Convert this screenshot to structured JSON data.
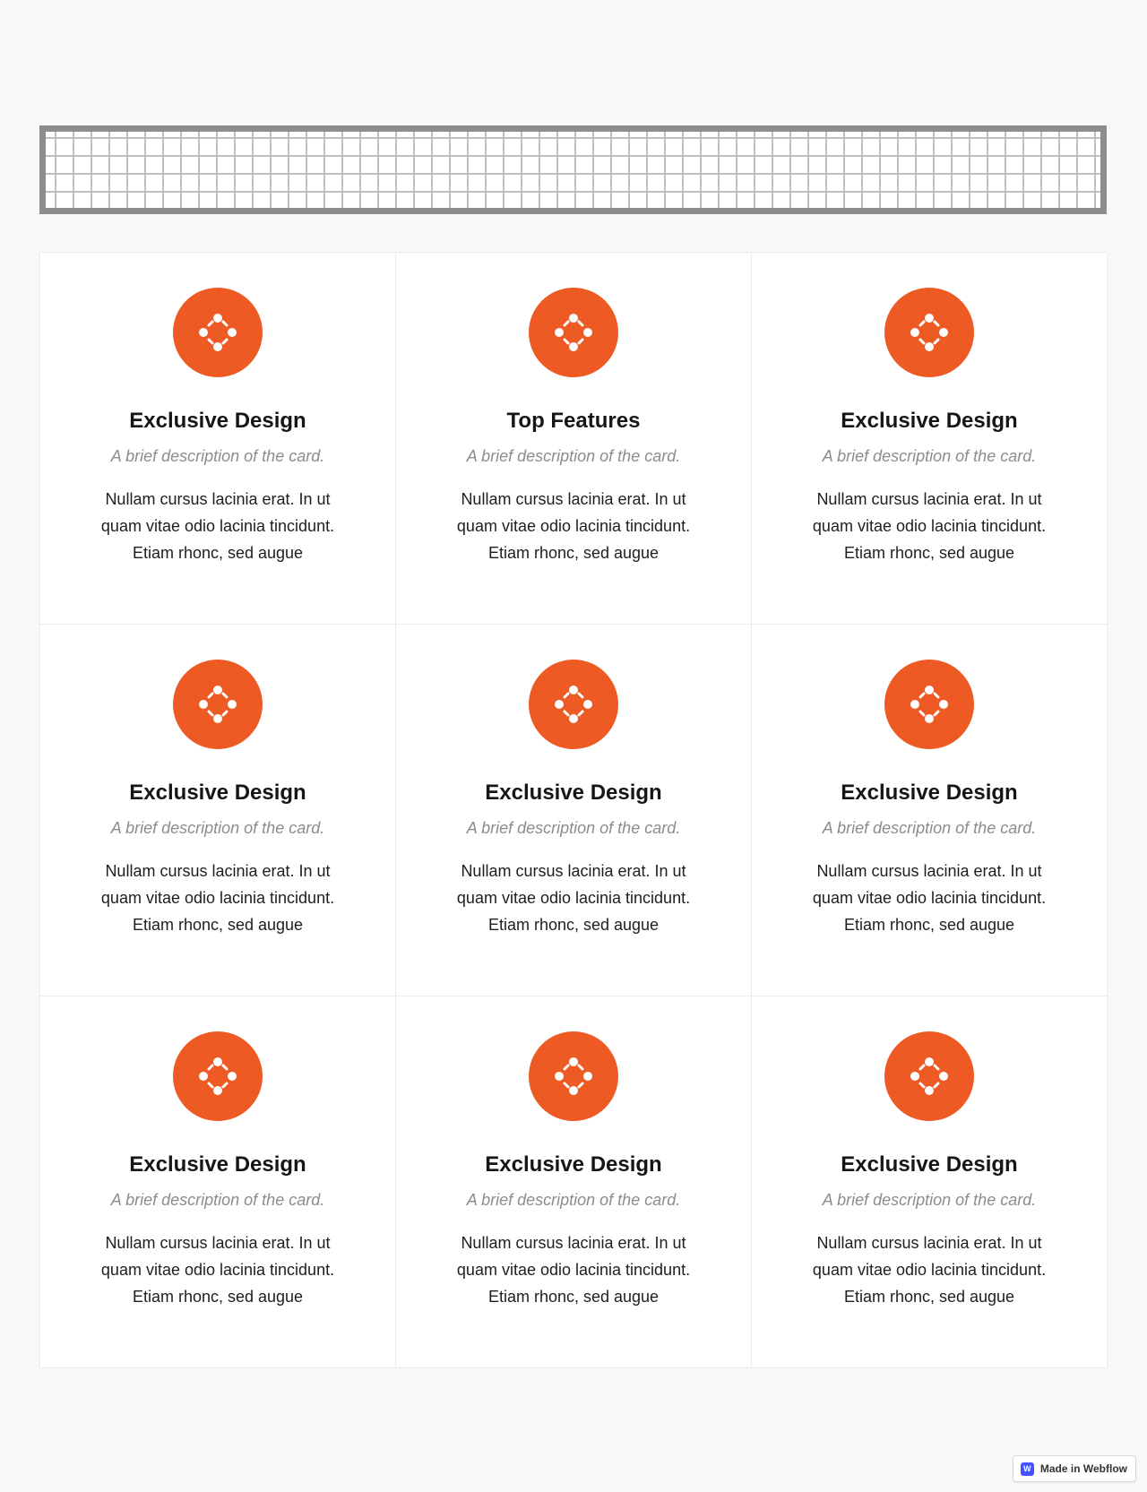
{
  "theme": {
    "accent": "#ee5a24",
    "card_background": "#ffffff",
    "page_background": "#f8f8f8"
  },
  "cards": [
    {
      "icon": "connected-dots-icon",
      "title": "Exclusive Design",
      "subtitle": "A brief description of the card.",
      "body": "Nullam cursus lacinia erat. In ut quam vitae odio lacinia tincidunt. Etiam rhonc, sed augue"
    },
    {
      "icon": "connected-dots-icon",
      "title": "Top Features",
      "subtitle": "A brief description of the card.",
      "body": "Nullam cursus lacinia erat. In ut quam vitae odio lacinia tincidunt. Etiam rhonc, sed augue"
    },
    {
      "icon": "connected-dots-icon",
      "title": "Exclusive Design",
      "subtitle": "A brief description of the card.",
      "body": "Nullam cursus lacinia erat. In ut quam vitae odio lacinia tincidunt. Etiam rhonc, sed augue"
    },
    {
      "icon": "connected-dots-icon",
      "title": "Exclusive Design",
      "subtitle": "A brief description of the card.",
      "body": "Nullam cursus lacinia erat. In ut quam vitae odio lacinia tincidunt. Etiam rhonc, sed augue"
    },
    {
      "icon": "connected-dots-icon",
      "title": "Exclusive Design",
      "subtitle": "A brief description of the card.",
      "body": "Nullam cursus lacinia erat. In ut quam vitae odio lacinia tincidunt. Etiam rhonc, sed augue"
    },
    {
      "icon": "connected-dots-icon",
      "title": "Exclusive Design",
      "subtitle": "A brief description of the card.",
      "body": "Nullam cursus lacinia erat. In ut quam vitae odio lacinia tincidunt. Etiam rhonc, sed augue"
    },
    {
      "icon": "connected-dots-icon",
      "title": "Exclusive Design",
      "subtitle": "A brief description of the card.",
      "body": "Nullam cursus lacinia erat. In ut quam vitae odio lacinia tincidunt. Etiam rhonc, sed augue"
    },
    {
      "icon": "connected-dots-icon",
      "title": "Exclusive Design",
      "subtitle": "A brief description of the card.",
      "body": "Nullam cursus lacinia erat. In ut quam vitae odio lacinia tincidunt. Etiam rhonc, sed augue"
    },
    {
      "icon": "connected-dots-icon",
      "title": "Exclusive Design",
      "subtitle": "A brief description of the card.",
      "body": "Nullam cursus lacinia erat. In ut quam vitae odio lacinia tincidunt. Etiam rhonc, sed augue"
    }
  ],
  "badge": {
    "logo_letter": "W",
    "label": "Made in Webflow",
    "icon": "webflow-logo-icon"
  }
}
